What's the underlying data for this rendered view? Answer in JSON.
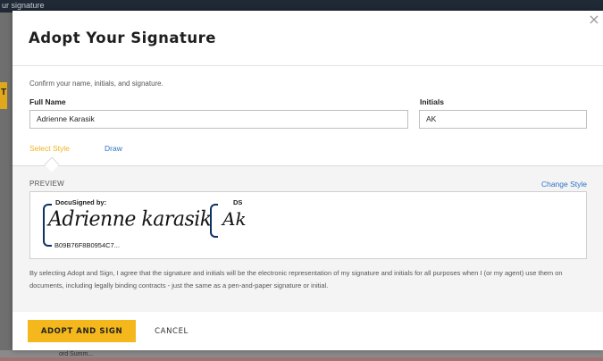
{
  "background": {
    "topbar_text": "ur signature",
    "left_tab_text": "T",
    "bottom_text": "ord Summ..."
  },
  "modal": {
    "title": "Adopt Your Signature",
    "close_glyph": "×",
    "instructions": "Confirm your name, initials, and signature.",
    "full_name": {
      "label": "Full Name",
      "value": "Adrienne Karasik"
    },
    "initials": {
      "label": "Initials",
      "value": "AK"
    },
    "tabs": [
      {
        "label": "Select Style",
        "active": true
      },
      {
        "label": "Draw",
        "active": false
      }
    ],
    "preview": {
      "label": "PREVIEW",
      "change_style": "Change Style",
      "signature": {
        "header": "DocuSigned by:",
        "script_text": "Adrienne karasik",
        "envelope_id": "B09B76F8B0954C7..."
      },
      "initials": {
        "header": "DS",
        "script_text": "Ak"
      }
    },
    "legal_text": "By selecting Adopt and Sign, I agree that the signature and initials will be the electronic representation of my signature and initials for all purposes when I (or my agent) use them on documents, including legally binding contracts - just the same as a pen-and-paper signature or initial.",
    "buttons": {
      "adopt": "ADOPT AND SIGN",
      "cancel": "CANCEL"
    }
  },
  "colors": {
    "accent": "#f5b81c",
    "link": "#2f73c6",
    "frame": "#0e3166"
  }
}
